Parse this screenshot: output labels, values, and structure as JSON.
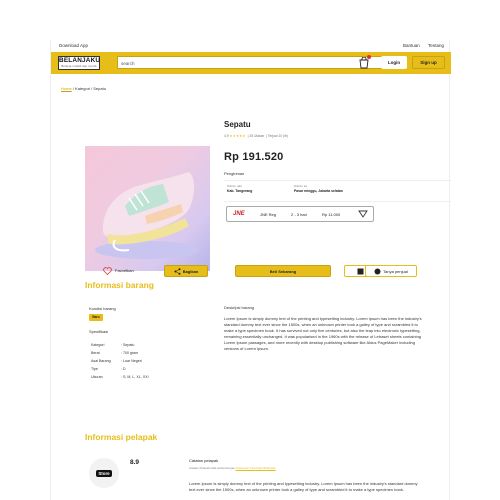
{
  "topbar": {
    "download": "Download App",
    "help": "Bantuan",
    "about": "Tentang"
  },
  "header": {
    "logo": "BELANJAKU",
    "logo_tagline": "Belanja mudah dan murah",
    "search_placeholder": "search",
    "login": "Login",
    "signup": "Sign up"
  },
  "breadcrumb": {
    "home": "Home",
    "rest": "/ Kategori / Sepatu"
  },
  "product": {
    "title": "Sepatu",
    "rating": "4.9",
    "stars": "★★★★★",
    "reviews": "28 Ulasan",
    "sold": "Terjual 10 (rb)",
    "price": "Rp 191.520",
    "shipping_label": "Pengiriman",
    "from_label": "Dikirim dari",
    "from_value": "Kab. Tangerang",
    "to_label": "Dikirim ke",
    "to_value": "Pasar minggu, Jakarta selatan",
    "courier": {
      "name": "JNE",
      "service": "JNE Reg",
      "duration": "2 - 3 hari",
      "cost": "Rp 11.000"
    }
  },
  "actions": {
    "favorite": "Favoritkan",
    "share": "Bagikan",
    "buy": "Beli Sekarang",
    "add_cart": "Masukan keranjang",
    "ask": "Tanya penjual"
  },
  "info": {
    "title": "Informasi barang",
    "condition_label": "Kondisi barang",
    "condition": "Baru",
    "spec_label": "Spesifikasi",
    "specs": [
      {
        "k": "Kategori",
        "v": ": Sepatu"
      },
      {
        "k": "Berat",
        "v": ": 700 gram"
      },
      {
        "k": "Asal Barang",
        "v": ": Luar Negeri"
      },
      {
        "k": "Tipe",
        "v": ": D"
      },
      {
        "k": "Ukuran",
        "v": ": S, M, L, XL, XXI"
      }
    ],
    "desc_label": "Deskripsi barang",
    "description": "Lorem Ipsum is simply dummy text of the printing and typesetting industry. Lorem Ipsum has been the industry's standard dummy text ever since the 1500s, when an unknown printer took a galley of type and scrambled it to make a type specimen book. It has survived not only five centuries, but also the leap into electronic typesetting, remaining essentially unchanged. It was popularised in the 1960s with the release of Letraset sheets containing Lorem Ipsum passages, and more recently with desktop publishing software like Aldus PageMaker including versions of Lorem Ipsum."
  },
  "seller": {
    "title": "Informasi pelapak",
    "logo_text": "Store",
    "rating": "8.9",
    "note_label": "Catatan pelapak",
    "note_sub": "Catatan Pelapak tidak terkait dengan ",
    "note_link": "Syarat dan Ketentuan Belanjaku",
    "note_body": "Lorem Ipsum is simply dummy text of the printing and typesetting industry. Lorem Ipsum has been the industry's standard dummy text ever since the 1500s, when an unknown printer took a galley of type and scrambled it to make a type specimen book."
  },
  "colors": {
    "accent": "#e7bd1a"
  },
  "icons": [
    "cart-icon",
    "heart-icon",
    "share-icon",
    "chevron-down-icon",
    "chat-icon",
    "cart-small-icon"
  ]
}
